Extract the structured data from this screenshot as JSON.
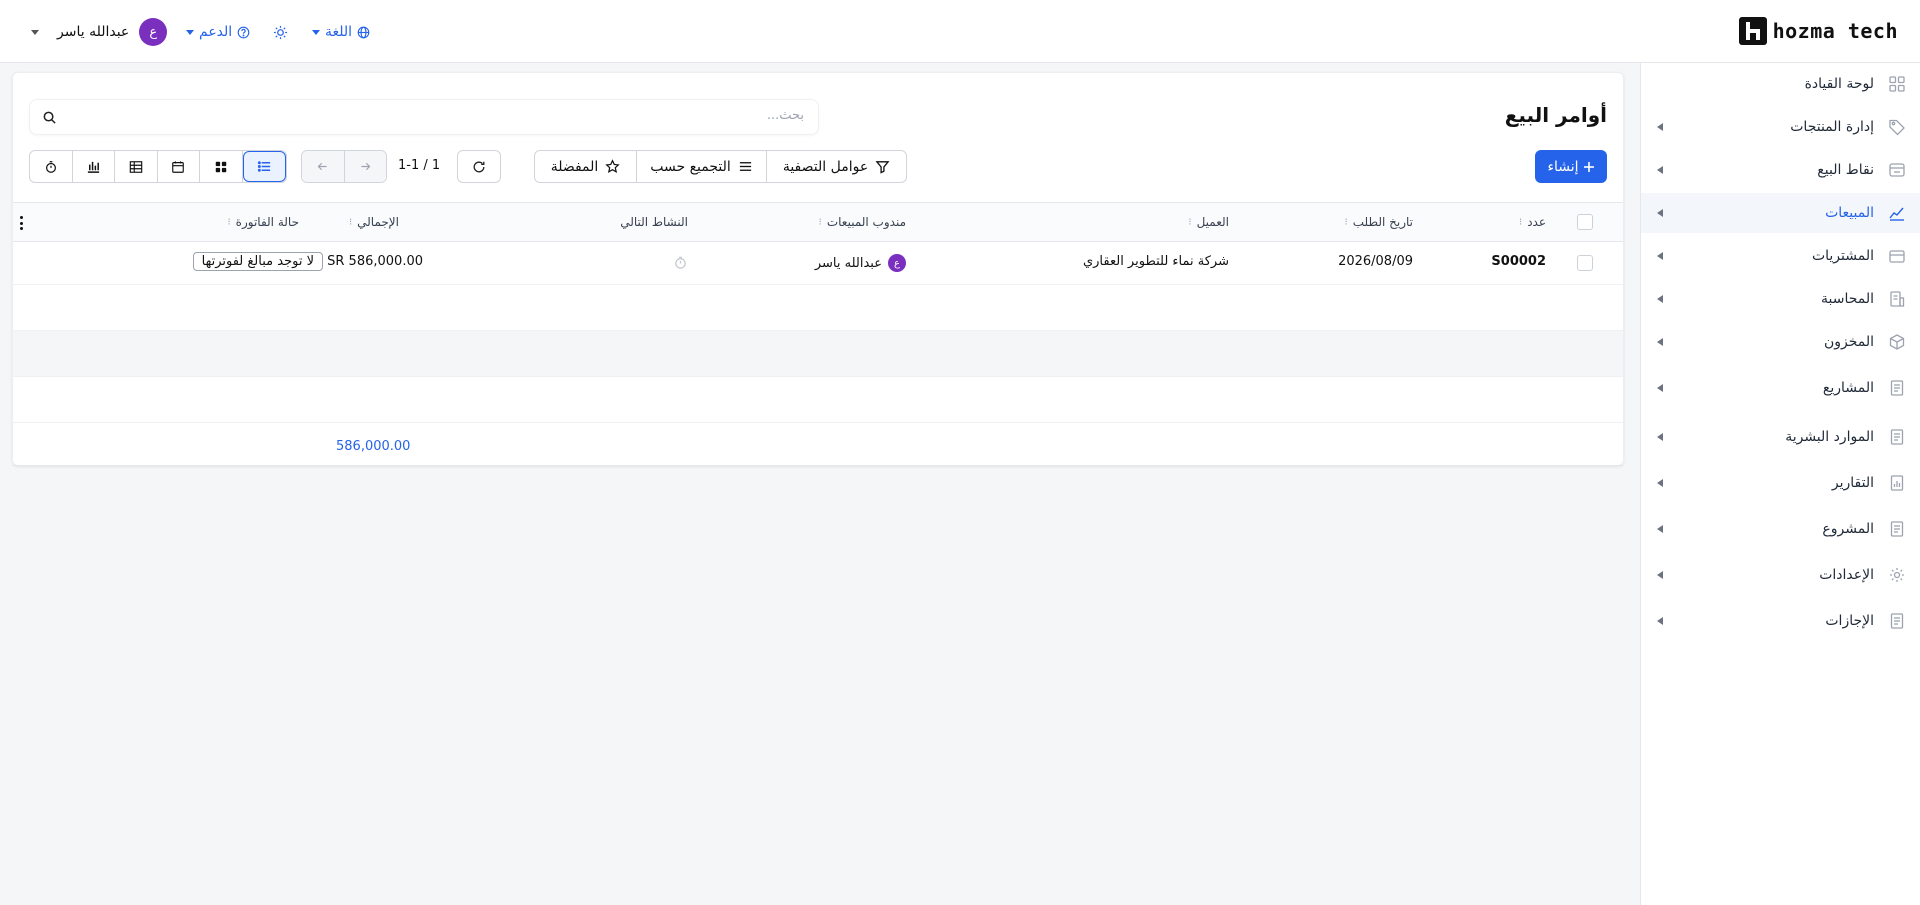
{
  "header": {
    "brand": "hozma tech",
    "user_name": "عبدالله ياسر",
    "user_initial": "ع",
    "support_label": "الدعم",
    "language_label": "اللغة"
  },
  "sidebar": {
    "items": [
      {
        "label": "لوحة القيادة",
        "icon": "dashboard-icon"
      },
      {
        "label": "إدارة المنتجات",
        "icon": "tag-icon"
      },
      {
        "label": "نقاط البيع",
        "icon": "store-icon"
      },
      {
        "label": "المبيعات",
        "icon": "chart-line-icon",
        "active": true
      },
      {
        "label": "المشتريات",
        "icon": "wallet-icon"
      },
      {
        "label": "المحاسبة",
        "icon": "ledger-icon"
      },
      {
        "label": "المخزون",
        "icon": "box-icon"
      },
      {
        "label": "المشاريع",
        "icon": "document-icon"
      },
      {
        "label": "الموارد البشرية",
        "icon": "document-icon"
      },
      {
        "label": "التقارير",
        "icon": "report-icon"
      },
      {
        "label": "المشروع",
        "icon": "document-icon"
      },
      {
        "label": "الإعدادات",
        "icon": "gear-icon"
      },
      {
        "label": "الإجازات",
        "icon": "document-icon"
      }
    ]
  },
  "main": {
    "title": "أوامر البيع",
    "search_placeholder": "بحث...",
    "create_label": "إنشاء",
    "filters_label": "عوامل التصفية",
    "groupby_label": "التجميع حسب",
    "favorites_label": "المفضلة",
    "pager": "1-1 / 1",
    "accent_color": "#2563eb"
  },
  "table": {
    "columns": {
      "number": "عدد",
      "order_date": "تاريخ الطلب",
      "customer": "العميل",
      "salesperson": "مندوب المبيعات",
      "next_activity": "النشاط التالي",
      "total": "الإجمالي",
      "invoice_status": "حالة الفاتورة"
    },
    "rows": [
      {
        "number": "S00002",
        "order_date": "2026/08/09",
        "customer": "شركة نماء للتطوير العقاري",
        "salesperson": "عبدالله ياسر",
        "salesperson_initial": "ع",
        "total": "SR 586,000.00",
        "invoice_status": "لا توجد مبالغ لفوترتها"
      }
    ],
    "sum_total": "586,000.00"
  }
}
